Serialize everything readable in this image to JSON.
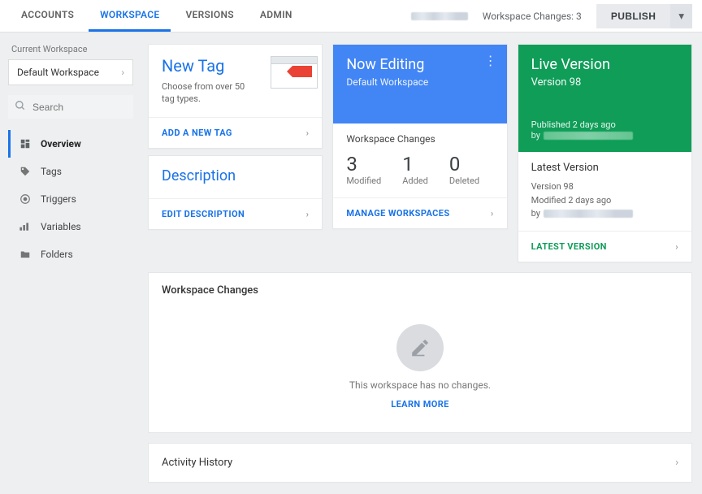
{
  "topnav": {
    "accounts": "ACCOUNTS",
    "workspace": "WORKSPACE",
    "versions": "VERSIONS",
    "admin": "ADMIN"
  },
  "header": {
    "changes_label": "Workspace Changes: 3",
    "publish": "PUBLISH"
  },
  "sidebar": {
    "current_label": "Current Workspace",
    "current_value": "Default Workspace",
    "search_placeholder": "Search",
    "items": [
      {
        "label": "Overview"
      },
      {
        "label": "Tags"
      },
      {
        "label": "Triggers"
      },
      {
        "label": "Variables"
      },
      {
        "label": "Folders"
      }
    ]
  },
  "newtag": {
    "title": "New Tag",
    "sub": "Choose from over 50 tag types.",
    "action": "ADD A NEW TAG"
  },
  "description": {
    "title": "Description",
    "action": "EDIT DESCRIPTION"
  },
  "editing": {
    "title": "Now Editing",
    "sub": "Default Workspace",
    "changes_heading": "Workspace Changes",
    "stats": [
      {
        "num": "3",
        "lbl": "Modified"
      },
      {
        "num": "1",
        "lbl": "Added"
      },
      {
        "num": "0",
        "lbl": "Deleted"
      }
    ],
    "action": "MANAGE WORKSPACES"
  },
  "live": {
    "title": "Live Version",
    "sub": "Version 98",
    "published": "Published 2 days ago",
    "by_prefix": "by",
    "latest_heading": "Latest Version",
    "latest_version": "Version 98",
    "latest_modified": "Modified 2 days ago",
    "latest_by_prefix": "by",
    "action": "LATEST VERSION"
  },
  "wc": {
    "title": "Workspace Changes",
    "empty": "This workspace has no changes.",
    "learn": "LEARN MORE"
  },
  "history": {
    "title": "Activity History"
  }
}
